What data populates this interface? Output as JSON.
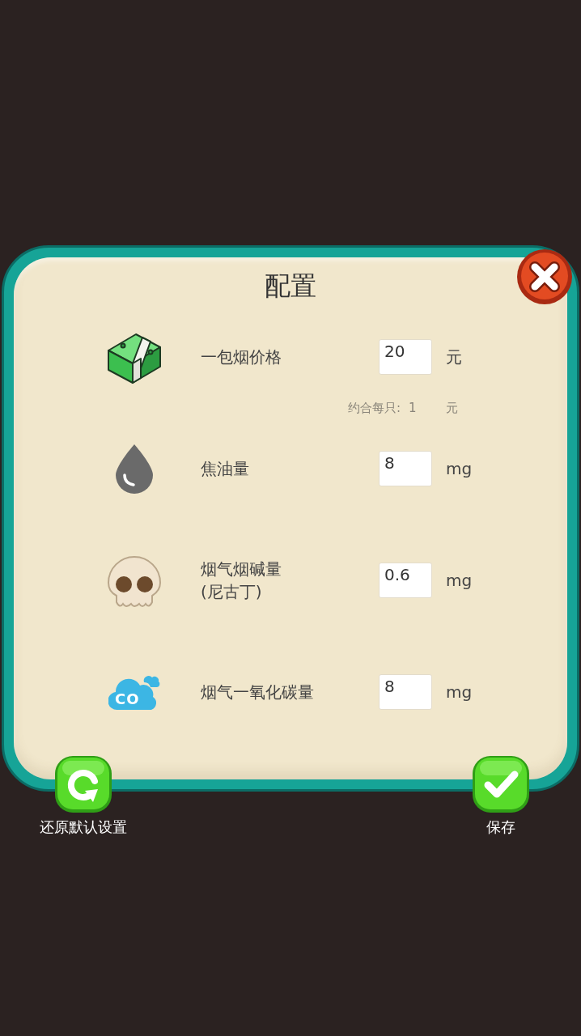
{
  "dialog": {
    "title": "配置",
    "settings": [
      {
        "label": "一包烟价格",
        "value": "20",
        "unit": "元",
        "per_item": {
          "label": "约合每只:",
          "value": "1",
          "unit": "元"
        }
      },
      {
        "label": "焦油量",
        "value": "8",
        "unit": "mg"
      },
      {
        "label": "烟气烟碱量",
        "sublabel": "(尼古丁)",
        "value": "0.6",
        "unit": "mg"
      },
      {
        "label": "烟气一氧化碳量",
        "value": "8",
        "unit": "mg",
        "icon_text": "CO"
      }
    ],
    "actions": [
      {
        "kind": "reset",
        "label": "还原默认设置"
      },
      {
        "kind": "save",
        "label": "保存"
      }
    ]
  }
}
